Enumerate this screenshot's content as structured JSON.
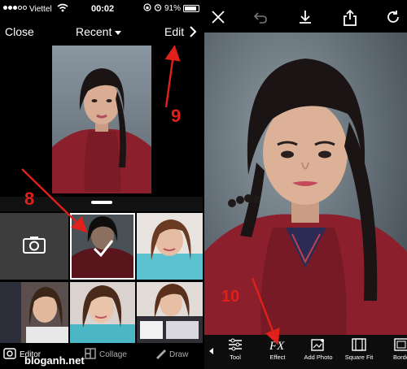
{
  "left_screen": {
    "status": {
      "carrier": "Viettel",
      "time": "00:02",
      "battery": "91%"
    },
    "navbar": {
      "close_label": "Close",
      "recent_label": "Recent",
      "edit_label": "Edit"
    },
    "tabs": [
      {
        "label": "Editor",
        "icon": "editor-icon"
      },
      {
        "label": "Collage",
        "icon": "collage-icon"
      },
      {
        "label": "Draw",
        "icon": "draw-icon"
      }
    ],
    "watermark": "bloganh.net"
  },
  "right_screen": {
    "top_icons": [
      "close-icon",
      "undo-icon",
      "download-icon",
      "share-icon",
      "refresh-icon"
    ],
    "tools": [
      {
        "label": "Tool",
        "icon": "sliders-icon"
      },
      {
        "label": "Effect",
        "icon": "fx-icon"
      },
      {
        "label": "Add Photo",
        "icon": "add-photo-icon"
      },
      {
        "label": "Square Fit",
        "icon": "square-fit-icon"
      },
      {
        "label": "Borde",
        "icon": "border-icon"
      }
    ]
  },
  "annotations": {
    "step8": "8",
    "step9": "9",
    "step10": "10"
  },
  "colors": {
    "annotation": "#e0201b",
    "sweater": "#8b1f2b"
  }
}
